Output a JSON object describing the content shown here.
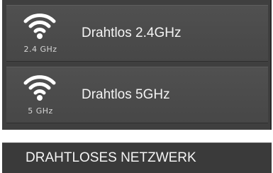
{
  "menu": {
    "items": [
      {
        "label": "Drahtlos 2.4GHz",
        "band": "2.4 GHz",
        "icon": "wifi-icon"
      },
      {
        "label": "Drahtlos 5GHz",
        "band": "5 GHz",
        "icon": "wifi-icon"
      }
    ]
  },
  "section": {
    "title": "DRAHTLOSES NETZWERK"
  },
  "colors": {
    "panel_bg": "#3f3f3f",
    "item_bg": "#4c4c4c",
    "text": "#f4f4f4",
    "icon": "#ffffff"
  }
}
